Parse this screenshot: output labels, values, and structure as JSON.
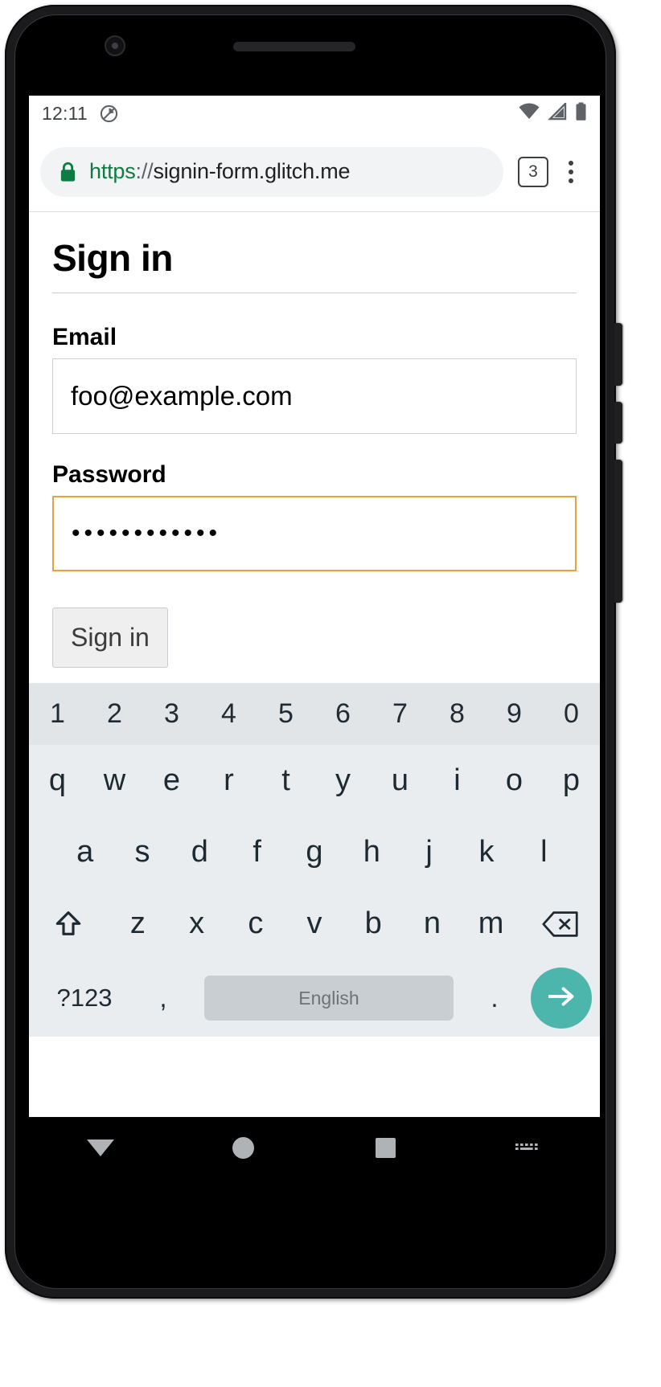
{
  "status_bar": {
    "time": "12:11",
    "icons": [
      "do-not-disturb-icon",
      "wifi-icon",
      "signal-icon",
      "battery-icon"
    ]
  },
  "browser": {
    "lock_icon": "lock-icon",
    "url_scheme": "https",
    "url_separator": "://",
    "url_host": "signin-form.glitch.me",
    "tab_count": "3",
    "menu_icon": "more-vertical-icon"
  },
  "page": {
    "title": "Sign in",
    "email": {
      "label": "Email",
      "value": "foo@example.com"
    },
    "password": {
      "label": "Password",
      "value": "••••••••••••",
      "focused": true,
      "focus_color": "#e8a33d"
    },
    "submit_label": "Sign in"
  },
  "keyboard": {
    "number_row": [
      "1",
      "2",
      "3",
      "4",
      "5",
      "6",
      "7",
      "8",
      "9",
      "0"
    ],
    "row1": [
      "q",
      "w",
      "e",
      "r",
      "t",
      "y",
      "u",
      "i",
      "o",
      "p"
    ],
    "row2": [
      "a",
      "s",
      "d",
      "f",
      "g",
      "h",
      "j",
      "k",
      "l"
    ],
    "row3": [
      "z",
      "x",
      "c",
      "v",
      "b",
      "n",
      "m"
    ],
    "shift_icon": "shift-arrow-icon",
    "backspace_icon": "backspace-icon",
    "symbols_label": "?123",
    "comma_label": ",",
    "space_label": "English",
    "period_label": ".",
    "enter_icon": "arrow-right-icon",
    "enter_color": "#4db6ac"
  },
  "nav_bar": {
    "back": "back-triangle-icon",
    "home": "home-circle-icon",
    "recents": "recents-square-icon",
    "keyboard": "keyboard-icon"
  }
}
